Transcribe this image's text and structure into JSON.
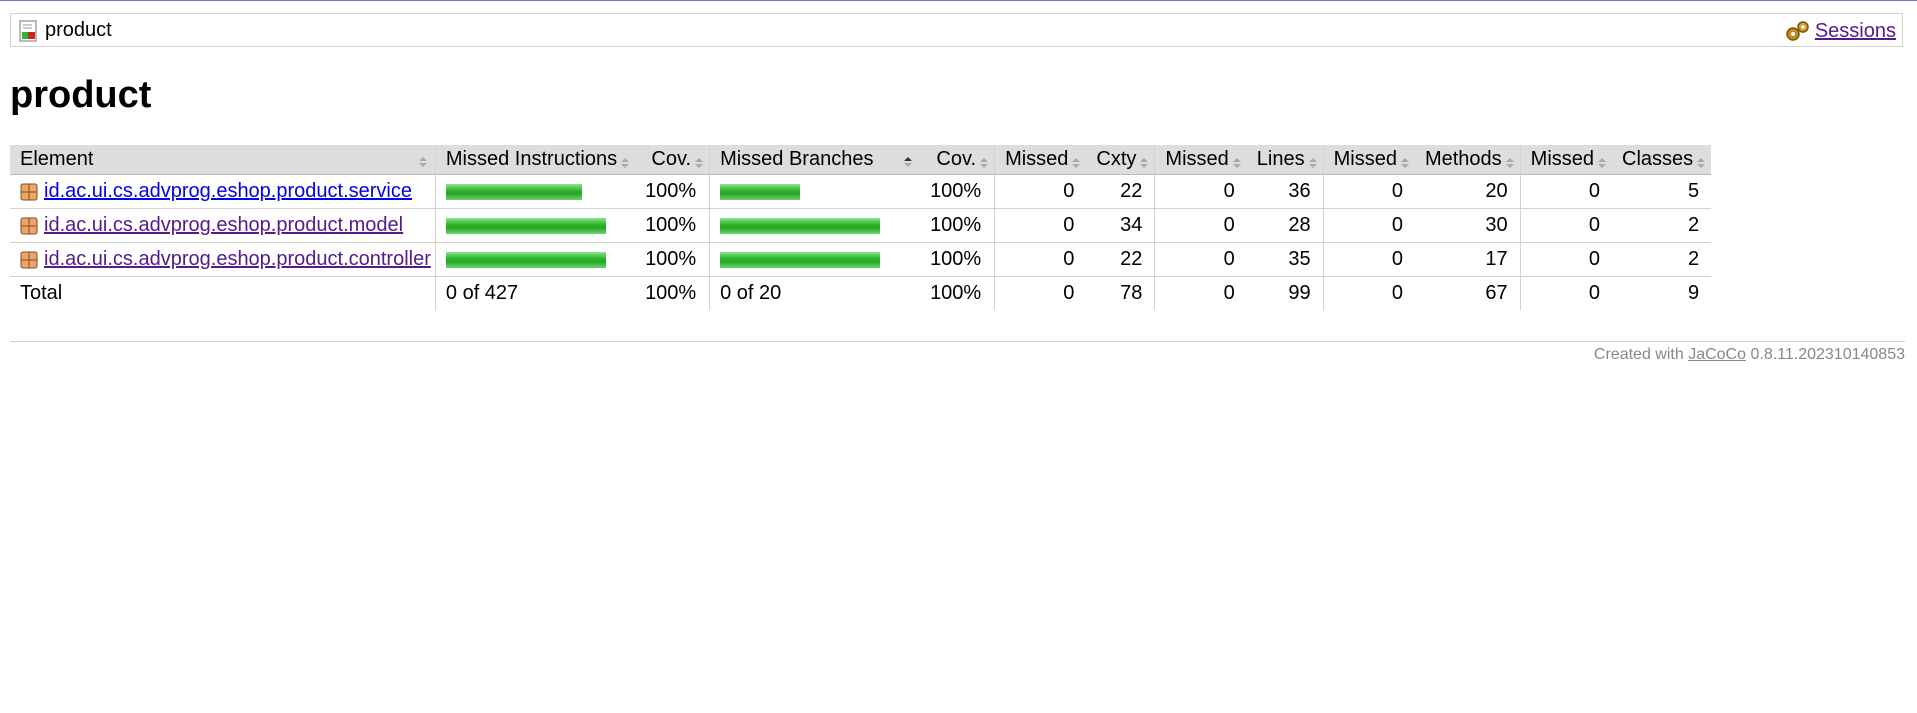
{
  "breadcrumb": {
    "title": "product",
    "sessions_label": "Sessions"
  },
  "page_title": "product",
  "table": {
    "headers": [
      "Element",
      "Missed Instructions",
      "Cov.",
      "Missed Branches",
      "Cov.",
      "Missed",
      "Cxty",
      "Missed",
      "Lines",
      "Missed",
      "Methods",
      "Missed",
      "Classes"
    ],
    "rows": [
      {
        "element": "id.ac.ui.cs.advprog.eshop.product.service",
        "instr_cov": "100%",
        "instr_bar_fraction": 0.85,
        "branch_cov": "100%",
        "branch_bar_fraction": 0.5,
        "missed_cxty": "0",
        "cxty": "22",
        "missed_lines": "0",
        "lines": "36",
        "missed_methods": "0",
        "methods": "20",
        "missed_classes": "0",
        "classes": "5"
      },
      {
        "element": "id.ac.ui.cs.advprog.eshop.product.model",
        "instr_cov": "100%",
        "instr_bar_fraction": 1.0,
        "branch_cov": "100%",
        "branch_bar_fraction": 1.0,
        "missed_cxty": "0",
        "cxty": "34",
        "missed_lines": "0",
        "lines": "28",
        "missed_methods": "0",
        "methods": "30",
        "missed_classes": "0",
        "classes": "2"
      },
      {
        "element": "id.ac.ui.cs.advprog.eshop.product.controller",
        "instr_cov": "100%",
        "instr_bar_fraction": 1.0,
        "branch_cov": "100%",
        "branch_bar_fraction": 1.0,
        "missed_cxty": "0",
        "cxty": "22",
        "missed_lines": "0",
        "lines": "35",
        "missed_methods": "0",
        "methods": "17",
        "missed_classes": "0",
        "classes": "2"
      }
    ],
    "total": {
      "label": "Total",
      "instructions": "0 of 427",
      "instr_cov": "100%",
      "branches": "0 of 20",
      "branch_cov": "100%",
      "missed_cxty": "0",
      "cxty": "78",
      "missed_lines": "0",
      "lines": "99",
      "missed_methods": "0",
      "methods": "67",
      "missed_classes": "0",
      "classes": "9"
    }
  },
  "footer": {
    "prefix": "Created with",
    "link": "JaCoCo",
    "version": "0.8.11.202310140853"
  },
  "colors": {
    "bar_green": "#2fb52f",
    "header_bg": "#dddddd",
    "link_visited": "#551a8b"
  }
}
